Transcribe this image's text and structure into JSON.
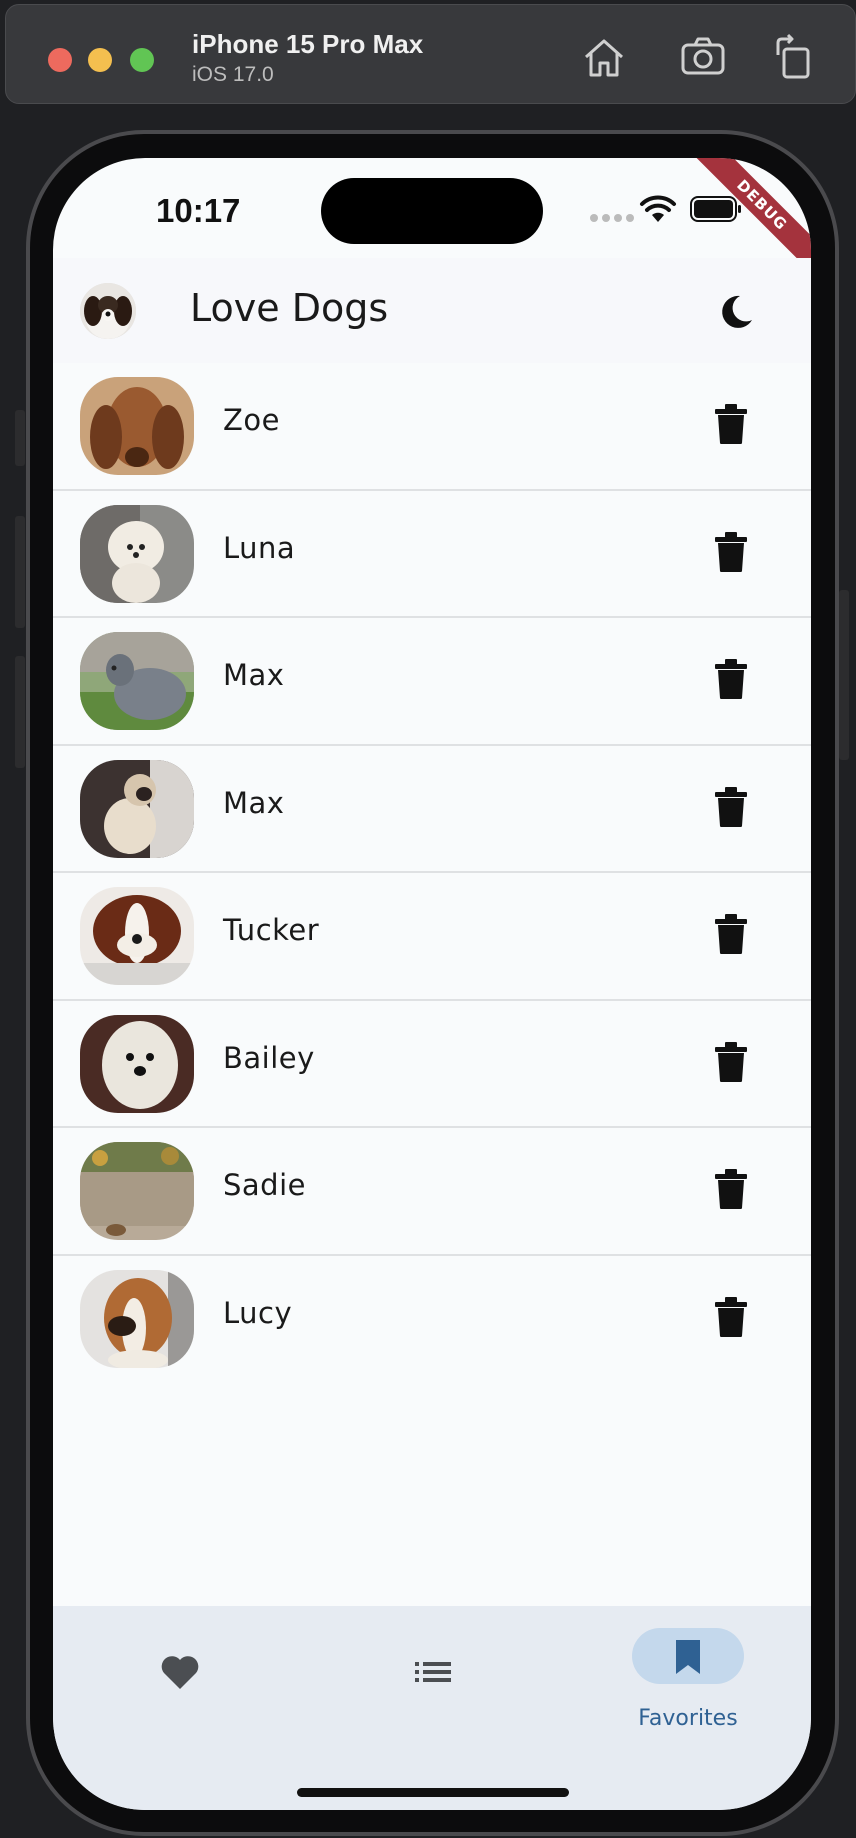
{
  "simulator": {
    "device_name": "iPhone 15 Pro Max",
    "os_version": "iOS 17.0",
    "toolbar_icons": [
      "home-icon",
      "screenshot-icon",
      "rotate-icon"
    ]
  },
  "status_bar": {
    "time": "10:17",
    "debug_banner": "DEBUG"
  },
  "app_bar": {
    "title": "Love Dogs",
    "theme_toggle_icon": "moon-icon"
  },
  "dogs": [
    {
      "name": "Zoe"
    },
    {
      "name": "Luna"
    },
    {
      "name": "Max"
    },
    {
      "name": "Max"
    },
    {
      "name": "Tucker"
    },
    {
      "name": "Bailey"
    },
    {
      "name": "Sadie"
    },
    {
      "name": "Lucy"
    }
  ],
  "bottom_nav": {
    "items": [
      {
        "icon": "heart-icon",
        "label": ""
      },
      {
        "icon": "list-icon",
        "label": ""
      },
      {
        "icon": "bookmark-icon",
        "label": "Favorites",
        "selected": true
      }
    ]
  },
  "colors": {
    "debug_ribbon": "#a4333d",
    "nav_background": "#e6ebf2",
    "nav_selected_pill": "#c4d8ec",
    "nav_selected_label": "#2f6193"
  }
}
